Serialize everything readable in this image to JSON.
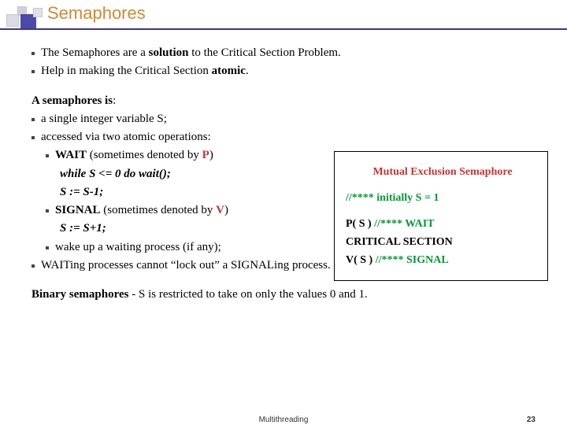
{
  "title": "Semaphores",
  "b1_pre": "The Semaphores are a ",
  "b1_bold": "solution",
  "b1_post": " to the Critical Section Problem.",
  "b2_pre": "Help in making the Critical Section ",
  "b2_bold": "atomic",
  "b2_post": ".",
  "heading1": "A semaphores is",
  "b3": "a single integer variable S;",
  "b4": "accessed via two atomic operations:",
  "wait_label": "WAIT",
  "wait_mid": " (sometimes denoted by ",
  "wait_p": "P",
  "close_paren": ")",
  "wait_code1": "while S <= 0 do wait();",
  "wait_code2": "S := S-1;",
  "signal_label": "SIGNAL",
  "signal_mid": " (sometimes denoted by ",
  "signal_v": "V",
  "signal_code": "S := S+1;",
  "wake": "wake up a waiting process (if any);",
  "lockout": "WAITing processes cannot “lock out” a SIGNALing process.",
  "binary_bold": "Binary semaphores",
  "binary_rest": " - S is restricted to take on only the values 0 and 1.",
  "box_title": "Mutual Exclusion Semaphore",
  "box_init": "//**** initially S = 1",
  "box_p": "P( S )  ",
  "box_p_cmt": "//**** WAIT",
  "box_cs": "CRITICAL SECTION",
  "box_v": "V( S )  ",
  "box_v_cmt": "//**** SIGNAL",
  "footer_center": "Multithreading",
  "footer_page": "23"
}
